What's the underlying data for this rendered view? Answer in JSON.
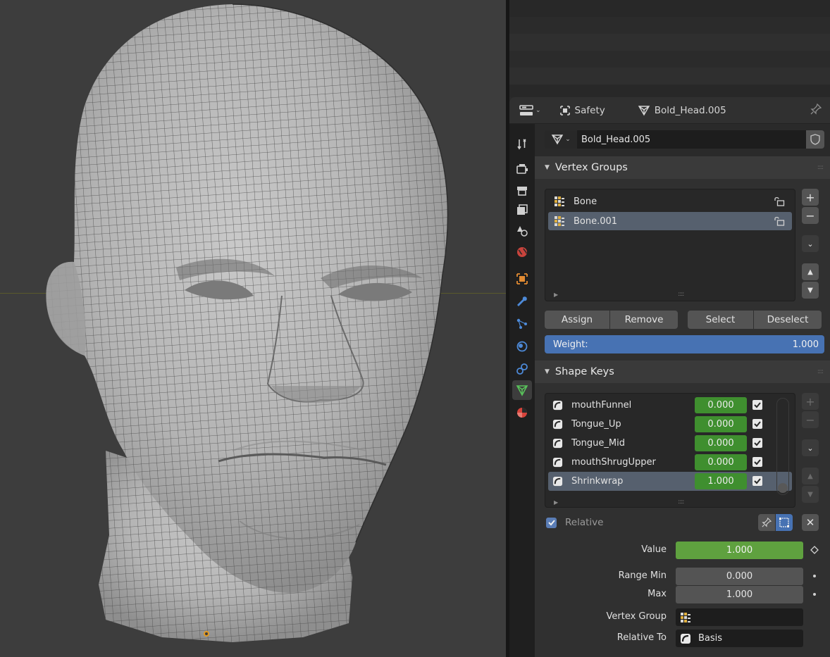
{
  "properties": {
    "header": {
      "object_name": "Safety",
      "mesh_name": "Bold_Head.005"
    },
    "mesh_datablock": {
      "name": "Bold_Head.005"
    },
    "vertex_groups": {
      "title": "Vertex Groups",
      "items": [
        {
          "name": "Bone",
          "selected": false
        },
        {
          "name": "Bone.001",
          "selected": true
        }
      ],
      "buttons": {
        "assign": "Assign",
        "remove": "Remove",
        "select": "Select",
        "deselect": "Deselect"
      },
      "weight_label": "Weight:",
      "weight_value": "1.000"
    },
    "shape_keys": {
      "title": "Shape Keys",
      "items": [
        {
          "name": "mouthFunnel",
          "value": "0.000",
          "enabled": true,
          "selected": false
        },
        {
          "name": "Tongue_Up",
          "value": "0.000",
          "enabled": true,
          "selected": false
        },
        {
          "name": "Tongue_Mid",
          "value": "0.000",
          "enabled": true,
          "selected": false
        },
        {
          "name": "mouthShrugUpper",
          "value": "0.000",
          "enabled": true,
          "selected": false
        },
        {
          "name": "Shrinkwrap",
          "value": "1.000",
          "enabled": true,
          "selected": true
        }
      ],
      "relative_label": "Relative",
      "relative_checked": true,
      "value_label": "Value",
      "value": "1.000",
      "range_min_label": "Range Min",
      "range_min": "0.000",
      "max_label": "Max",
      "max": "1.000",
      "vertex_group_label": "Vertex Group",
      "vertex_group": "",
      "relative_to_label": "Relative To",
      "relative_to": "Basis"
    }
  },
  "colors": {
    "accent_blue": "#4772b3",
    "value_green": "#5fa13f",
    "list_green": "#3f8f2f",
    "selected_row": "#56606e",
    "origin_orange": "#e69a1e"
  }
}
